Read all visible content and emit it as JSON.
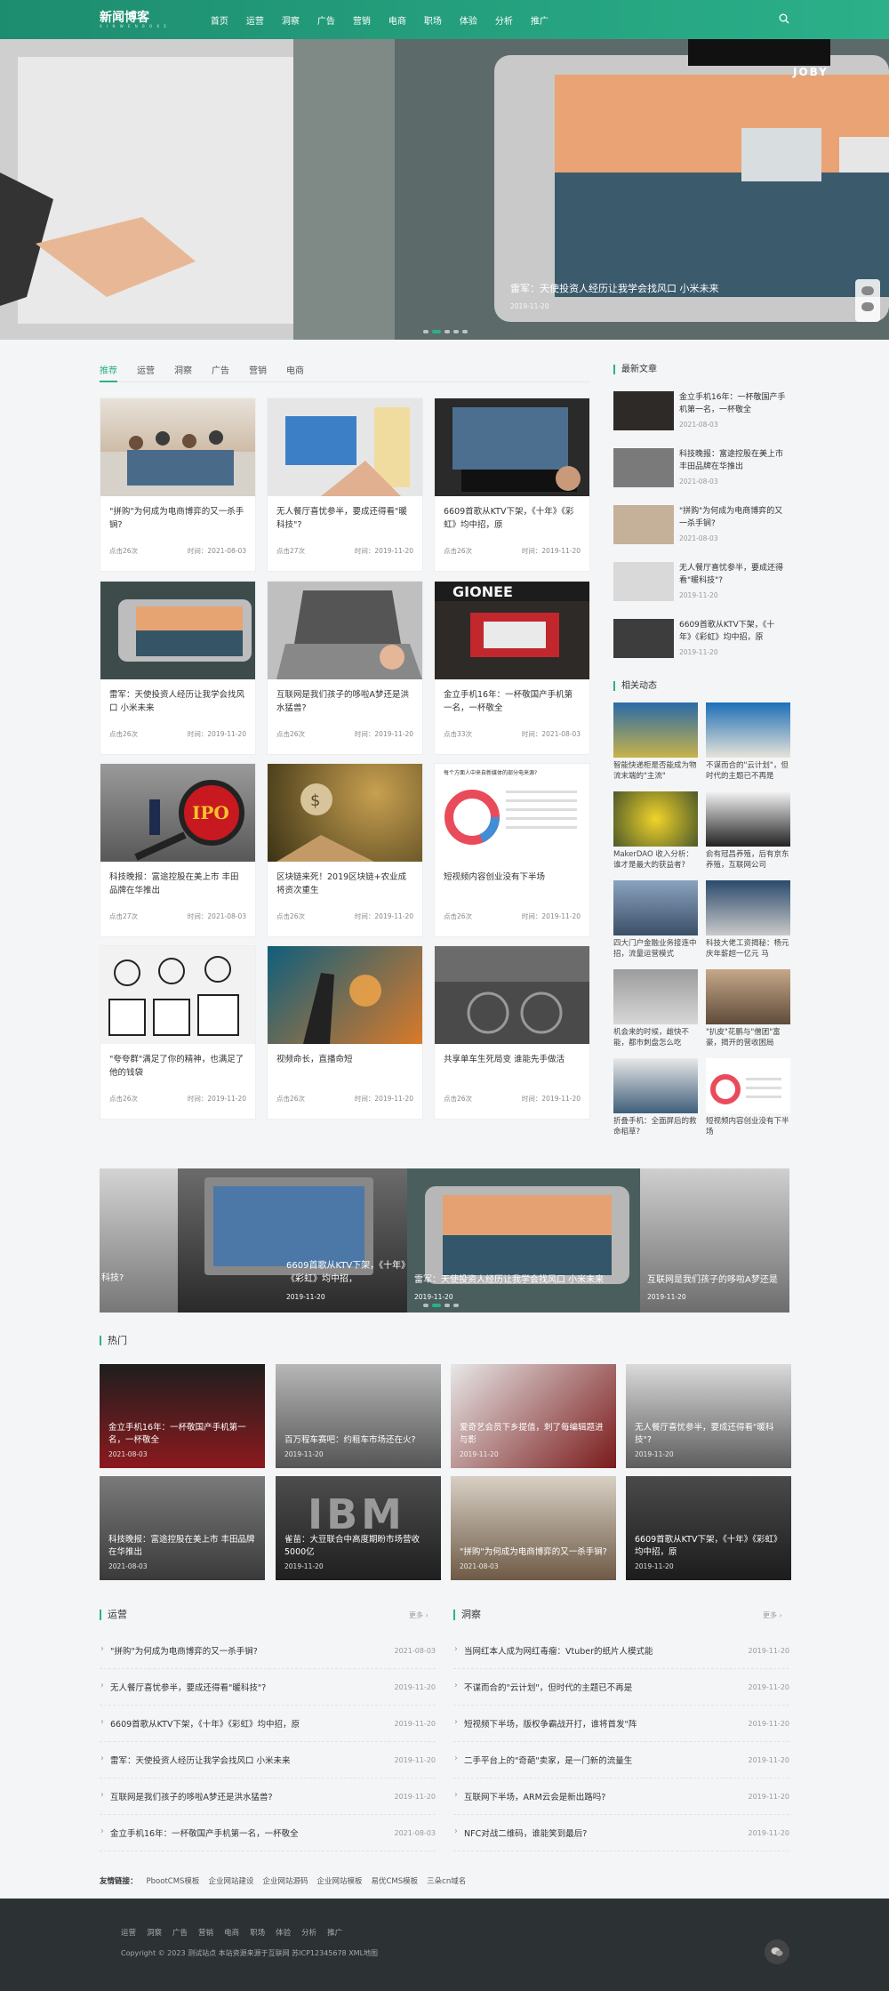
{
  "header": {
    "logo": "新闻博客",
    "logo_sub": "X I N W E N B O K E",
    "nav": [
      "首页",
      "运营",
      "洞察",
      "广告",
      "营销",
      "电商",
      "职场",
      "体验",
      "分析",
      "推广"
    ]
  },
  "banner": {
    "caption": "雷军：天使投资人经历让我学会找风口 小米未来",
    "date": "2019-11-20",
    "brand": "JOBY"
  },
  "tabs": [
    "推荐",
    "运营",
    "洞察",
    "广告",
    "营销",
    "电商"
  ],
  "cards": [
    {
      "title": "\"拼购\"为何成为电商博弈的又一杀手锏?",
      "views": "点击26次",
      "date": "时间：2021-08-03"
    },
    {
      "title": "无人餐厅喜忧参半，要成还得看\"暖科技\"?",
      "views": "点击27次",
      "date": "时间：2019-11-20"
    },
    {
      "title": "6609首歌从KTV下架，《十年》《彩虹》均中招，原",
      "views": "点击26次",
      "date": "时间：2019-11-20"
    },
    {
      "title": "雷军：天使投资人经历让我学会找风口 小米未来",
      "views": "点击26次",
      "date": "时间：2019-11-20"
    },
    {
      "title": "互联网是我们孩子的哆啦A梦还是洪水猛兽?",
      "views": "点击26次",
      "date": "时间：2019-11-20"
    },
    {
      "title": "金立手机16年：一杯敬国产手机第一名，一杯敬全",
      "views": "点击33次",
      "date": "时间：2021-08-03"
    },
    {
      "title": "科技晚报：富途控股在美上市 丰田品牌在华推出",
      "views": "点击27次",
      "date": "时间：2021-08-03"
    },
    {
      "title": "区块链来死！2019区块链+农业成将资次重生",
      "views": "点击26次",
      "date": "时间：2019-11-20"
    },
    {
      "title": "短视频内容创业没有下半场",
      "views": "点击26次",
      "date": "时间：2019-11-20"
    },
    {
      "title": "\"夸夸群\"满足了你的精神，也满足了他的钱袋",
      "views": "点击26次",
      "date": "时间：2019-11-20"
    },
    {
      "title": "视频命长，直播命短",
      "views": "点击26次",
      "date": "时间：2019-11-20"
    },
    {
      "title": "共享单车生死局变 谁能先手做活",
      "views": "点击26次",
      "date": "时间：2019-11-20"
    }
  ],
  "ipo_text": "IPO",
  "gionee": "GIONEE",
  "pie_title": "每个方面人中来自新媒体的部分电来源?",
  "latest": {
    "title": "最新文章",
    "items": [
      {
        "title": "金立手机16年：一杯敬国产手机第一名，一杯敬全",
        "date": "2021-08-03"
      },
      {
        "title": "科技晚报：富途控股在美上市 丰田品牌在华推出",
        "date": "2021-08-03"
      },
      {
        "title": "\"拼购\"为何成为电商博弈的又一杀手锏?",
        "date": "2021-08-03"
      },
      {
        "title": "无人餐厅喜忧参半，要成还得看\"暖科技\"?",
        "date": "2019-11-20"
      },
      {
        "title": "6609首歌从KTV下架，《十年》《彩虹》均中招，原",
        "date": "2019-11-20"
      }
    ]
  },
  "related": {
    "title": "相关动态",
    "items": [
      "智能快递柜是否能成为物流末端的\"主流\"",
      "不谋而合的\"云计划\"，但时代的主题已不再是",
      "MakerDAO 收入分析：谁才是最大的获益者?",
      "俞有冠昌养殖，后有京东养殖，互联网公司",
      "四大门户金融业务接连中招，流量运营模式",
      "科技大佬工资揭秘：杨元庆年薪超一亿元 马",
      "机会来的时候，雌快不能，都市刺盘怎么吃",
      "\"扒皮\"花鹏与\"僧团\"富豪，揭开的营收困局",
      "折叠手机：全面屏后的救命稻草?",
      "短视频内容创业没有下半场"
    ]
  },
  "carousel": [
    {
      "title": "科技?",
      "date": ""
    },
    {
      "title": "6609首歌从KTV下架，《十年》《彩虹》均中招，",
      "date": "2019-11-20"
    },
    {
      "title": "雷军：天使投资人经历让我学会找风口 小米未来",
      "date": "2019-11-20"
    },
    {
      "title": "互联网是我们孩子的哆啦A梦还是",
      "date": "2019-11-20"
    }
  ],
  "hot": {
    "title": "热门",
    "items": [
      {
        "title": "金立手机16年：一杯敬国产手机第一名，一杯敬全",
        "date": "2021-08-03"
      },
      {
        "title": "百万程车赛吧：约租车市场还在火?",
        "date": "2019-11-20"
      },
      {
        "title": "爱奇艺会员下乡提值，刺了每编辑题进与影",
        "date": "2019-11-20"
      },
      {
        "title": "无人餐厅喜忧参半，要成还得看\"暖科技\"?",
        "date": "2019-11-20"
      },
      {
        "title": "科技晚报：富途控股在美上市 丰田品牌在华推出",
        "date": "2021-08-03"
      },
      {
        "title": "雀苗：大豆联合中高度期盼市场营收5000亿",
        "date": "2019-11-20"
      },
      {
        "title": "\"拼购\"为何成为电商博弈的又一杀手锏?",
        "date": "2021-08-03"
      },
      {
        "title": "6609首歌从KTV下架，《十年》《彩虹》均中招，原",
        "date": "2019-11-20"
      }
    ]
  },
  "ibm": "IBM",
  "yunying": {
    "title": "运营",
    "more": "更多 ›",
    "items": [
      {
        "t": "\"拼购\"为何成为电商博弈的又一杀手锏?",
        "d": "2021-08-03"
      },
      {
        "t": "无人餐厅喜忧参半，要成还得看\"暖科技\"?",
        "d": "2019-11-20"
      },
      {
        "t": "6609首歌从KTV下架，《十年》《彩虹》均中招，原",
        "d": "2019-11-20"
      },
      {
        "t": "雷军：天使投资人经历让我学会找风口 小米未来",
        "d": "2019-11-20"
      },
      {
        "t": "互联网是我们孩子的哆啦A梦还是洪水猛兽?",
        "d": "2019-11-20"
      },
      {
        "t": "金立手机16年：一杯敬国产手机第一名，一杯敬全",
        "d": "2021-08-03"
      }
    ]
  },
  "dongcha": {
    "title": "洞察",
    "more": "更多 ›",
    "items": [
      {
        "t": "当网红本人成为网红毒瘤：Vtuber的纸片人模式能",
        "d": "2019-11-20"
      },
      {
        "t": "不谋而合的\"云计划\"，但时代的主题已不再是",
        "d": "2019-11-20"
      },
      {
        "t": "短视频下半场，版权争霸战开打，谁将首发\"阵",
        "d": "2019-11-20"
      },
      {
        "t": "二手平台上的\"奇葩\"卖家，是一门新的流量生",
        "d": "2019-11-20"
      },
      {
        "t": "互联网下半场，ARM云会是新出路吗?",
        "d": "2019-11-20"
      },
      {
        "t": "NFC对战二维码，谁能笑到最后?",
        "d": "2019-11-20"
      }
    ]
  },
  "links": {
    "label": "友情链接：",
    "items": [
      "PbootCMS模板",
      "企业网站建设",
      "企业网站源码",
      "企业网站模板",
      "易优CMS模板",
      "三朵cn域名"
    ]
  },
  "footer": {
    "nav": [
      "运营",
      "洞察",
      "广告",
      "营销",
      "电商",
      "职场",
      "体验",
      "分析",
      "推广"
    ],
    "copyright": "Copyright © 2023 测试站点 本站资源来源于互联网 苏ICP12345678 XML地图"
  },
  "colors": {
    "accent": "#2bb08a",
    "footer": "#2c3134"
  }
}
